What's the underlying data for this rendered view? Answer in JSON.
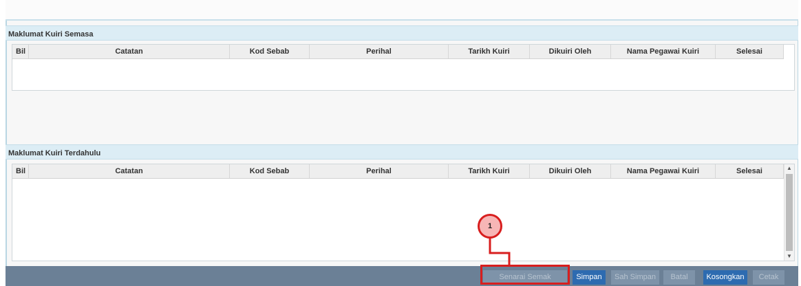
{
  "sections": [
    {
      "title": "Maklumat Kuiri Semasa"
    },
    {
      "title": "Maklumat Kuiri Terdahulu"
    }
  ],
  "columns": [
    "Bil",
    "Catatan",
    "Kod Sebab",
    "Perihal",
    "Tarikh Kuiri",
    "Dikuiri Oleh",
    "Nama Pegawai Kuiri",
    "Selesai"
  ],
  "toolbar": {
    "senarai_semak": "Senarai Semak",
    "simpan": "Simpan",
    "sah_simpan": "Sah Simpan",
    "batal": "Batal",
    "kosongkan": "Kosongkan",
    "cetak": "Cetak"
  },
  "annotation": {
    "number": "1"
  },
  "colors": {
    "header_bg": "#dcedf5",
    "toolbar_bg": "#6b8096",
    "active_button": "#2d6bb0",
    "callout_red": "#d81e1e"
  }
}
